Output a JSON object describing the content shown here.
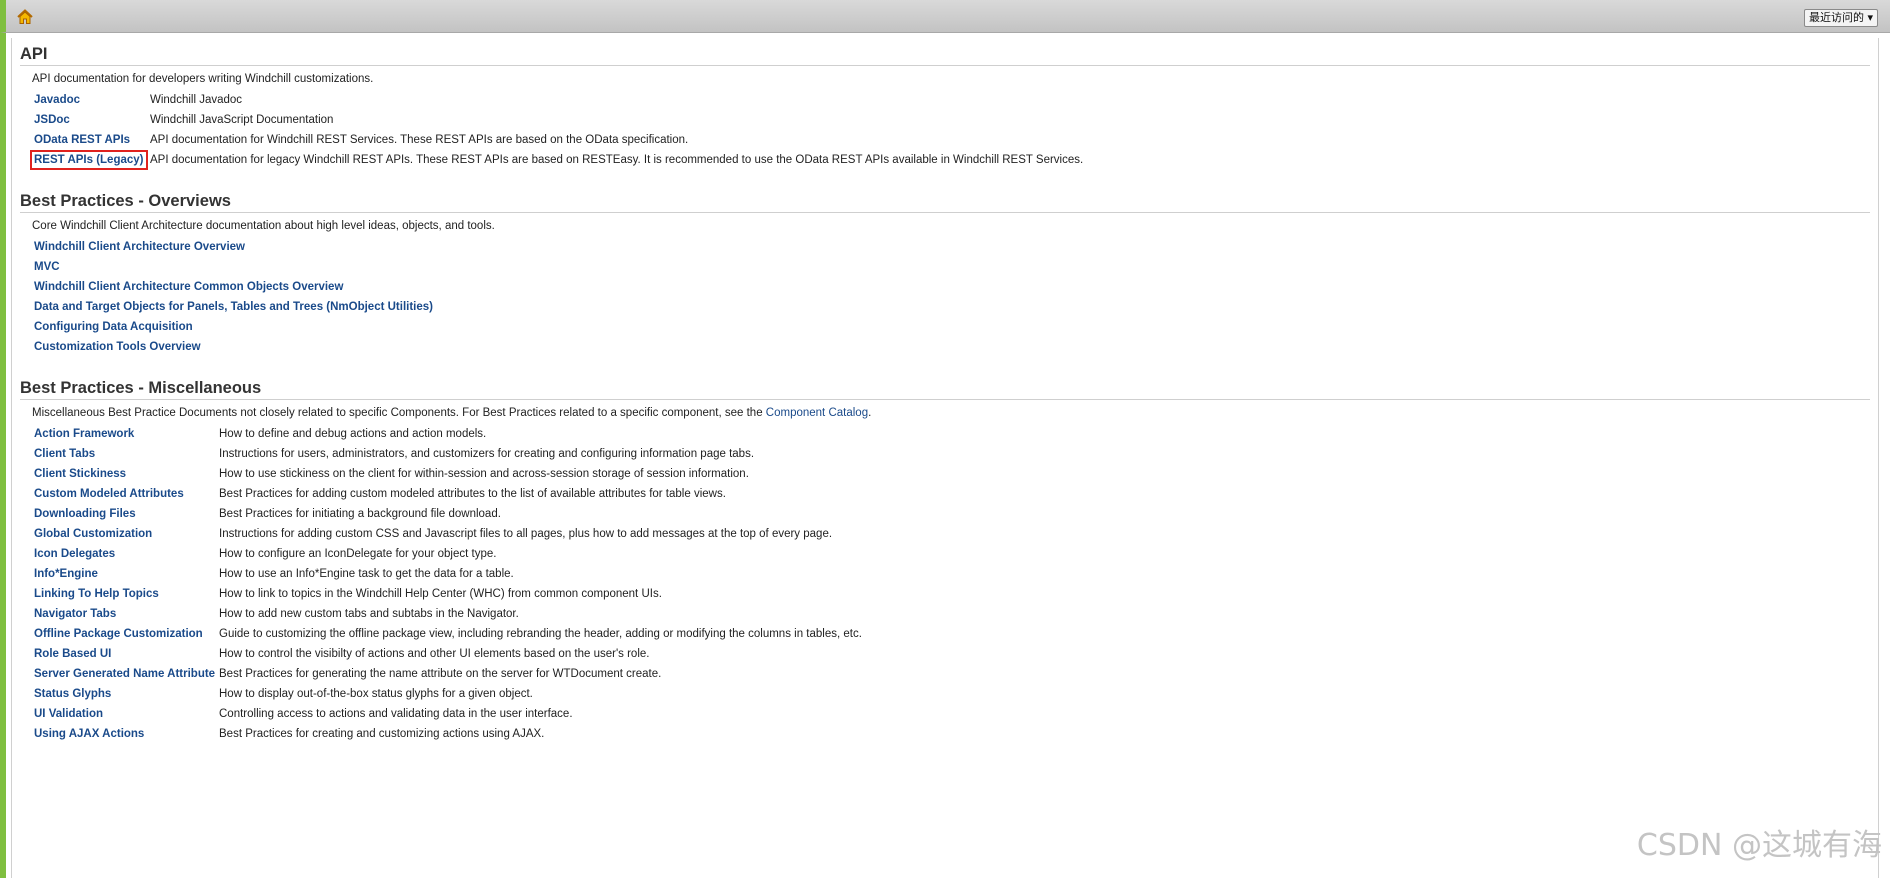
{
  "toolbar": {
    "recent_label": "最近访问的 ▾"
  },
  "api": {
    "title": "API",
    "description": "API documentation for developers writing Windchill customizations.",
    "items": [
      {
        "label": "Javadoc",
        "desc": "Windchill Javadoc"
      },
      {
        "label": "JSDoc",
        "desc": "Windchill JavaScript Documentation"
      },
      {
        "label": "OData REST APIs",
        "desc": "API documentation for Windchill REST Services. These REST APIs are based on the OData specification."
      },
      {
        "label": "REST APIs (Legacy)",
        "desc": "API documentation for legacy Windchill REST APIs. These REST APIs are based on RESTEasy. It is recommended to use the OData REST APIs available in Windchill REST Services."
      }
    ]
  },
  "overviews": {
    "title": "Best Practices - Overviews",
    "description": "Core Windchill Client Architecture documentation about high level ideas, objects, and tools.",
    "items": [
      {
        "label": "Windchill Client Architecture Overview"
      },
      {
        "label": "MVC"
      },
      {
        "label": "Windchill Client Architecture Common Objects Overview"
      },
      {
        "label": "Data and Target Objects for Panels, Tables and Trees (NmObject Utilities)"
      },
      {
        "label": "Configuring Data Acquisition"
      },
      {
        "label": "Customization Tools Overview"
      }
    ]
  },
  "misc": {
    "title": "Best Practices - Miscellaneous",
    "description_prefix": "Miscellaneous Best Practice Documents not closely related to specific Components.  For Best Practices related to a specific component, see the ",
    "description_link": "Component Catalog",
    "description_suffix": ".",
    "items": [
      {
        "label": "Action Framework",
        "desc": "How to define and debug actions and action models."
      },
      {
        "label": "Client Tabs",
        "desc": "Instructions for users, administrators, and customizers for creating and configuring information page tabs."
      },
      {
        "label": "Client Stickiness",
        "desc": "How to use stickiness on the client for within-session and across-session storage of session information."
      },
      {
        "label": "Custom Modeled Attributes",
        "desc": "Best Practices for adding custom modeled attributes to the list of available attributes for table views."
      },
      {
        "label": "Downloading Files",
        "desc": "Best Practices for initiating a background file download."
      },
      {
        "label": "Global Customization",
        "desc": "Instructions for adding custom CSS and Javascript files to all pages, plus how to add messages at the top of every page."
      },
      {
        "label": "Icon Delegates",
        "desc": "How to configure an IconDelegate for your object type."
      },
      {
        "label": "Info*Engine",
        "desc": "How to use an Info*Engine task to get the data for a table."
      },
      {
        "label": "Linking To Help Topics",
        "desc": "How to link to topics in the Windchill Help Center (WHC) from common component UIs."
      },
      {
        "label": "Navigator Tabs",
        "desc": "How to add new custom tabs and subtabs in the Navigator."
      },
      {
        "label": "Offline Package Customization",
        "desc": "Guide to customizing the offline package view, including rebranding the header, adding or modifying the columns in tables, etc."
      },
      {
        "label": "Role Based UI",
        "desc": "How to control the visibilty of actions and other UI elements based on the user's role."
      },
      {
        "label": "Server Generated Name Attribute",
        "desc": "Best Practices for generating the name attribute on the server for WTDocument create."
      },
      {
        "label": "Status Glyphs",
        "desc": "How to display out-of-the-box status glyphs for a given object."
      },
      {
        "label": "UI Validation",
        "desc": "Controlling access to actions and validating data in the user interface."
      },
      {
        "label": "Using AJAX Actions",
        "desc": "Best Practices for creating and customizing actions using AJAX."
      }
    ]
  },
  "watermark": "CSDN @这城有海"
}
